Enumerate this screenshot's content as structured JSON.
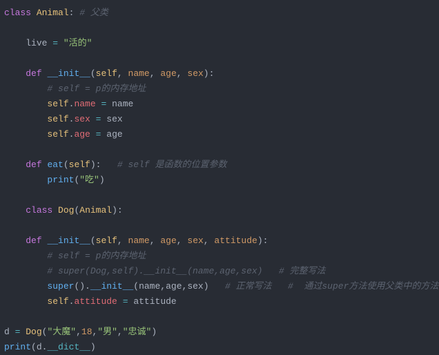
{
  "code": {
    "l1": {
      "kw1": "class",
      "name": "Animal",
      "cmt": "# 父类"
    },
    "l3": {
      "var": "live",
      "op": "=",
      "val": "\"活的\""
    },
    "l5": {
      "kw": "def",
      "fn": "__init__",
      "self": "self",
      "p1": "name",
      "p2": "age",
      "p3": "sex"
    },
    "l6": {
      "cmt": "# self = p的内存地址"
    },
    "l7": {
      "self": "self",
      "attr": "name",
      "op": "=",
      "val": "name"
    },
    "l8": {
      "self": "self",
      "attr": "sex",
      "op": "=",
      "val": "sex"
    },
    "l9": {
      "self": "self",
      "attr": "age",
      "op": "=",
      "val": "age"
    },
    "l11": {
      "kw": "def",
      "fn": "eat",
      "self": "self",
      "cmt": "# self 是函数的位置参数"
    },
    "l12": {
      "fn": "print",
      "val": "\"吃\""
    },
    "l14": {
      "kw": "class",
      "name": "Dog",
      "base": "Animal"
    },
    "l16": {
      "kw": "def",
      "fn": "__init__",
      "self": "self",
      "p1": "name",
      "p2": "age",
      "p3": "sex",
      "p4": "attitude"
    },
    "l17": {
      "cmt": "# self = p的内存地址"
    },
    "l18": {
      "cmt": "# super(Dog,self).__init__(name,age,sex)   # 完整写法"
    },
    "l19": {
      "fn1": "super",
      "fn2": "__init__",
      "a1": "name",
      "a2": "age",
      "a3": "sex",
      "cmt": "# 正常写法   #  通过super方法使用父类中的方法"
    },
    "l20": {
      "self": "self",
      "attr": "attitude",
      "op": "=",
      "val": "attitude"
    },
    "l22": {
      "var": "d",
      "op": "=",
      "cls": "Dog",
      "a1": "\"大魔\"",
      "a2": "18",
      "a3": "\"男\"",
      "a4": "\"忠诚\""
    },
    "l23": {
      "fn": "print",
      "var": "d",
      "attr": "__dict__"
    }
  }
}
